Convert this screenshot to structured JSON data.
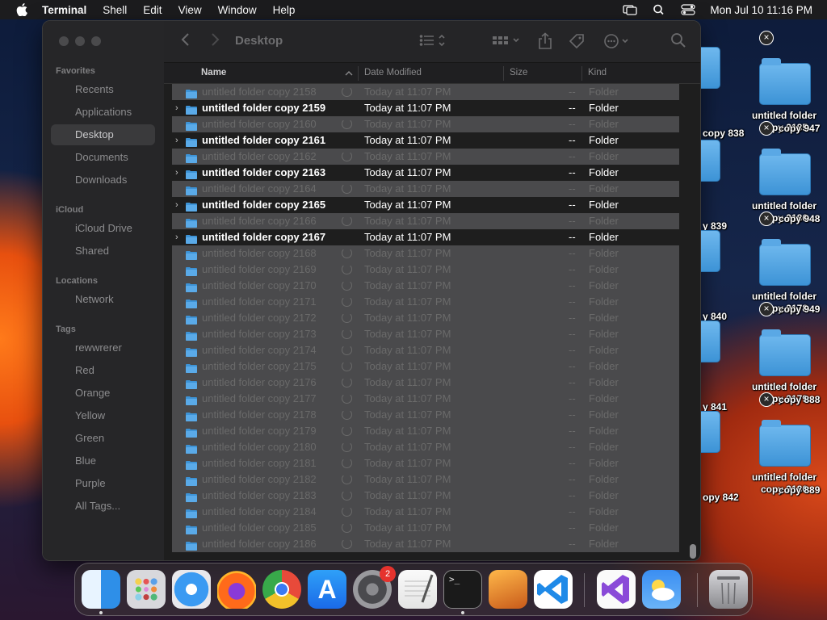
{
  "menubar": {
    "app": "Terminal",
    "items": [
      "Shell",
      "Edit",
      "View",
      "Window",
      "Help"
    ],
    "datetime": "Mon Jul 10  11:16 PM"
  },
  "finder": {
    "title": "Desktop",
    "sidebar": {
      "favorites_heading": "Favorites",
      "favorites": [
        "Recents",
        "Applications",
        "Desktop",
        "Documents",
        "Downloads"
      ],
      "icloud_heading": "iCloud",
      "icloud": [
        "iCloud Drive",
        "Shared"
      ],
      "locations_heading": "Locations",
      "locations": [
        "Network"
      ],
      "tags_heading": "Tags",
      "tags": [
        "rewwrerer",
        "Red",
        "Orange",
        "Yellow",
        "Green",
        "Blue",
        "Purple",
        "All Tags..."
      ]
    },
    "columns": {
      "name": "Name",
      "date": "Date Modified",
      "size": "Size",
      "kind": "Kind"
    },
    "rows": [
      {
        "name": "untitled folder copy 2158",
        "date": "Today at 11:07 PM",
        "size": "--",
        "kind": "Folder",
        "state": "sel"
      },
      {
        "name": "untitled folder copy 2159",
        "date": "Today at 11:07 PM",
        "size": "--",
        "kind": "Folder",
        "state": "hi"
      },
      {
        "name": "untitled folder copy 2160",
        "date": "Today at 11:07 PM",
        "size": "--",
        "kind": "Folder",
        "state": "sel"
      },
      {
        "name": "untitled folder copy 2161",
        "date": "Today at 11:07 PM",
        "size": "--",
        "kind": "Folder",
        "state": "hi"
      },
      {
        "name": "untitled folder copy 2162",
        "date": "Today at 11:07 PM",
        "size": "--",
        "kind": "Folder",
        "state": "sel"
      },
      {
        "name": "untitled folder copy 2163",
        "date": "Today at 11:07 PM",
        "size": "--",
        "kind": "Folder",
        "state": "hi"
      },
      {
        "name": "untitled folder copy 2164",
        "date": "Today at 11:07 PM",
        "size": "--",
        "kind": "Folder",
        "state": "sel"
      },
      {
        "name": "untitled folder copy 2165",
        "date": "Today at 11:07 PM",
        "size": "--",
        "kind": "Folder",
        "state": "hi"
      },
      {
        "name": "untitled folder copy 2166",
        "date": "Today at 11:07 PM",
        "size": "--",
        "kind": "Folder",
        "state": "sel"
      },
      {
        "name": "untitled folder copy 2167",
        "date": "Today at 11:07 PM",
        "size": "--",
        "kind": "Folder",
        "state": "hi"
      },
      {
        "name": "untitled folder copy 2168",
        "date": "Today at 11:07 PM",
        "size": "--",
        "kind": "Folder",
        "state": "sel"
      },
      {
        "name": "untitled folder copy 2169",
        "date": "Today at 11:07 PM",
        "size": "--",
        "kind": "Folder",
        "state": "sel"
      },
      {
        "name": "untitled folder copy 2170",
        "date": "Today at 11:07 PM",
        "size": "--",
        "kind": "Folder",
        "state": "sel"
      },
      {
        "name": "untitled folder copy 2171",
        "date": "Today at 11:07 PM",
        "size": "--",
        "kind": "Folder",
        "state": "sel"
      },
      {
        "name": "untitled folder copy 2172",
        "date": "Today at 11:07 PM",
        "size": "--",
        "kind": "Folder",
        "state": "sel"
      },
      {
        "name": "untitled folder copy 2173",
        "date": "Today at 11:07 PM",
        "size": "--",
        "kind": "Folder",
        "state": "sel"
      },
      {
        "name": "untitled folder copy 2174",
        "date": "Today at 11:07 PM",
        "size": "--",
        "kind": "Folder",
        "state": "sel"
      },
      {
        "name": "untitled folder copy 2175",
        "date": "Today at 11:07 PM",
        "size": "--",
        "kind": "Folder",
        "state": "sel"
      },
      {
        "name": "untitled folder copy 2176",
        "date": "Today at 11:07 PM",
        "size": "--",
        "kind": "Folder",
        "state": "sel"
      },
      {
        "name": "untitled folder copy 2177",
        "date": "Today at 11:07 PM",
        "size": "--",
        "kind": "Folder",
        "state": "sel"
      },
      {
        "name": "untitled folder copy 2178",
        "date": "Today at 11:07 PM",
        "size": "--",
        "kind": "Folder",
        "state": "sel"
      },
      {
        "name": "untitled folder copy 2179",
        "date": "Today at 11:07 PM",
        "size": "--",
        "kind": "Folder",
        "state": "sel"
      },
      {
        "name": "untitled folder copy 2180",
        "date": "Today at 11:07 PM",
        "size": "--",
        "kind": "Folder",
        "state": "sel"
      },
      {
        "name": "untitled folder copy 2181",
        "date": "Today at 11:07 PM",
        "size": "--",
        "kind": "Folder",
        "state": "sel"
      },
      {
        "name": "untitled folder copy 2182",
        "date": "Today at 11:07 PM",
        "size": "--",
        "kind": "Folder",
        "state": "sel"
      },
      {
        "name": "untitled folder copy 2183",
        "date": "Today at 11:07 PM",
        "size": "--",
        "kind": "Folder",
        "state": "sel"
      },
      {
        "name": "untitled folder copy 2184",
        "date": "Today at 11:07 PM",
        "size": "--",
        "kind": "Folder",
        "state": "sel"
      },
      {
        "name": "untitled folder copy 2185",
        "date": "Today at 11:07 PM",
        "size": "--",
        "kind": "Folder",
        "state": "sel"
      },
      {
        "name": "untitled folder copy 2186",
        "date": "Today at 11:07 PM",
        "size": "--",
        "kind": "Folder",
        "state": "sel"
      }
    ]
  },
  "desktop_icons": [
    {
      "line1": "untitled folder",
      "line2": "copy 2185"
    },
    {
      "line1": "untitled folder",
      "line2": "copy 2186"
    },
    {
      "line1": "untitled folder",
      "line2": "copy 2178"
    },
    {
      "line1": "untitled folder",
      "line2": "copy 2179"
    },
    {
      "line1": "untitled folder",
      "line2": "copy 2180"
    }
  ],
  "desktop_partial_labels": [
    "copy 838",
    "y 839",
    "y 840",
    "y 841",
    "opy 842",
    "copy 947",
    "copy 948",
    "copy 949",
    "copy 888",
    "copy 889"
  ],
  "dock": {
    "items": [
      "finder",
      "launchpad",
      "safari",
      "firefox",
      "chrome",
      "app-store",
      "system-settings",
      "textedit",
      "terminal",
      "garageband",
      "vscode",
      "visual-studio",
      "weather",
      "trash"
    ],
    "settings_badge": "2"
  },
  "colors": {
    "menubar": "#1c1c1e",
    "window": "#1e1e1e",
    "selection": "#4a4a4c",
    "folder_blue": "#3d93d6"
  }
}
